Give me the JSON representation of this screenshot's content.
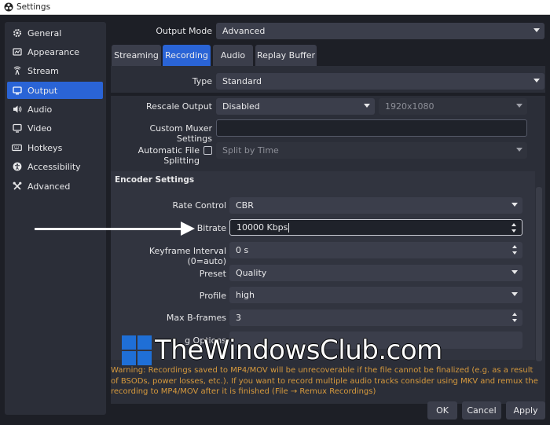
{
  "window": {
    "title": "Settings"
  },
  "sidebar": {
    "items": [
      {
        "label": "General",
        "icon": "gear-icon"
      },
      {
        "label": "Appearance",
        "icon": "palette-icon"
      },
      {
        "label": "Stream",
        "icon": "antenna-icon"
      },
      {
        "label": "Output",
        "icon": "monitor-output-icon",
        "active": true
      },
      {
        "label": "Audio",
        "icon": "speaker-icon"
      },
      {
        "label": "Video",
        "icon": "monitor-icon"
      },
      {
        "label": "Hotkeys",
        "icon": "keyboard-icon"
      },
      {
        "label": "Accessibility",
        "icon": "accessibility-icon"
      },
      {
        "label": "Advanced",
        "icon": "tools-icon"
      }
    ]
  },
  "output_mode": {
    "label": "Output Mode",
    "value": "Advanced"
  },
  "tabs": [
    {
      "label": "Streaming"
    },
    {
      "label": "Recording",
      "active": true
    },
    {
      "label": "Audio"
    },
    {
      "label": "Replay Buffer"
    }
  ],
  "type": {
    "label": "Type",
    "value": "Standard"
  },
  "rescale": {
    "label": "Rescale Output",
    "value": "Disabled",
    "resolution": "1920x1080"
  },
  "muxer": {
    "label": "Custom Muxer Settings",
    "value": ""
  },
  "splitting": {
    "label": "Automatic File Splitting",
    "checked": false,
    "value": "Split by Time"
  },
  "encoder": {
    "heading": "Encoder Settings",
    "rate_control": {
      "label": "Rate Control",
      "value": "CBR"
    },
    "bitrate": {
      "label": "Bitrate",
      "value": "10000 Kbps"
    },
    "keyframe": {
      "label": "Keyframe Interval (0=auto)",
      "value": "0 s"
    },
    "preset": {
      "label": "Preset",
      "value": "Quality"
    },
    "profile": {
      "label": "Profile",
      "value": "high"
    },
    "bframes": {
      "label": "Max B-frames",
      "value": "3"
    },
    "options": {
      "label": "FFmpeg Options",
      "visible_label": "g Options"
    }
  },
  "warning": "Warning: Recordings saved to MP4/MOV will be unrecoverable if the file cannot be finalized (e.g. as a result of BSODs, power losses, etc.). If you want to record multiple audio tracks consider using MKV and remux the recording to MP4/MOV after it is finished (File → Remux Recordings)",
  "buttons": {
    "ok": "OK",
    "cancel": "Cancel",
    "apply": "Apply"
  },
  "watermark": {
    "text": "TheWindowsClub.com"
  },
  "colors": {
    "accent": "#2a64d6",
    "background": "#1d1f26",
    "panel": "#2b2e38",
    "field": "#3b3e4b",
    "warning": "#d79a3d"
  }
}
